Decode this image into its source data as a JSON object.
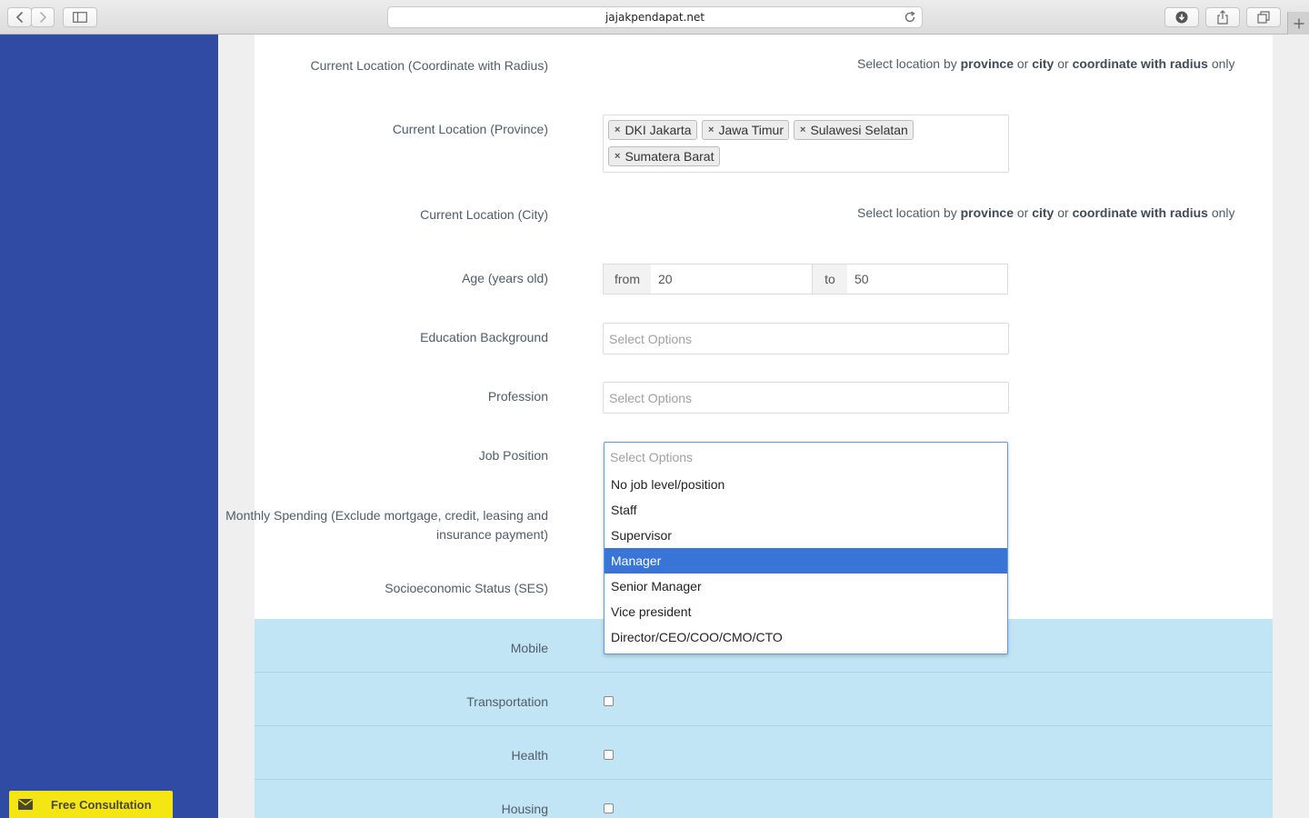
{
  "browser": {
    "url": "jajakpendapat.net",
    "icons": [
      "back-icon",
      "forward-icon",
      "sidebar-icon",
      "reload-icon",
      "download-icon",
      "share-icon",
      "tabs-icon",
      "new-tab-icon"
    ]
  },
  "form": {
    "coordinate": {
      "label": "Current Location (Coordinate with Radius)",
      "note_prefix": "Select location by",
      "province": "province",
      "or1": "or",
      "city": "city",
      "or2": "or",
      "coordinate": "coordinate with radius",
      "suffix": "only"
    },
    "province": {
      "label": "Current Location (Province)",
      "tags": [
        "DKI Jakarta",
        "Jawa Timur",
        "Sulawesi Selatan",
        "Sumatera Barat"
      ],
      "remove_glyph": "×"
    },
    "city": {
      "label": "Current Location (City)",
      "note_prefix": "Select location by",
      "province": "province",
      "or1": "or",
      "city": "city",
      "or2": "or",
      "coordinate": "coordinate with radius",
      "suffix": "only"
    },
    "age": {
      "label": "Age (years old)",
      "from_label": "from",
      "from_value": "20",
      "to_label": "to",
      "to_value": "50"
    },
    "education": {
      "label": "Education Background",
      "placeholder": "Select Options"
    },
    "profession": {
      "label": "Profession",
      "placeholder": "Select Options"
    },
    "job_position": {
      "label": "Job Position",
      "placeholder": "Select Options",
      "options": [
        "No job level/position",
        "Staff",
        "Supervisor",
        "Manager",
        "Senior Manager",
        "Vice president",
        "Director/CEO/COO/CMO/CTO"
      ],
      "highlighted": "Manager"
    },
    "monthly_spending": {
      "label": "Monthly Spending (Exclude mortgage, credit, leasing and insurance payment)"
    },
    "ses": {
      "label": "Socioeconomic Status (SES)"
    }
  },
  "ownership": {
    "items": [
      "Mobile",
      "Transportation",
      "Health",
      "Housing"
    ]
  },
  "consultation": {
    "label": "Free Consultation",
    "icon": "envelope-icon",
    "color": "#f4e613"
  },
  "colors": {
    "sidebar": "#2f4ba4",
    "highlight": "#3875d7",
    "section_bg": "#c2e5f5"
  }
}
